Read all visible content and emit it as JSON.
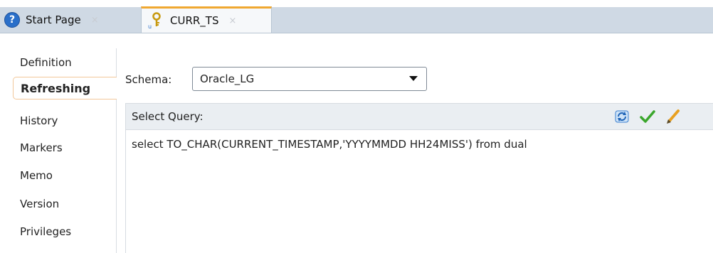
{
  "tabs": [
    {
      "label": "Start Page",
      "icon": "help-icon",
      "close": "×"
    },
    {
      "label": "CURR_TS",
      "icon": "key-icon",
      "close": "×"
    }
  ],
  "help_glyph": "?",
  "nav": {
    "items": [
      "Definition",
      "Refreshing",
      "History",
      "Markers",
      "Memo",
      "Version",
      "Privileges"
    ],
    "active": "Refreshing"
  },
  "schema": {
    "label": "Schema:",
    "value": "Oracle_LG"
  },
  "query": {
    "label": "Select Query:",
    "text": "select TO_CHAR(CURRENT_TIMESTAMP,'YYYYMMDD HH24MISS') from dual",
    "actions": [
      "refresh-icon",
      "check-icon",
      "pencil-icon"
    ]
  },
  "colors": {
    "tab_strip": "#cfd9e4",
    "active_tab_accent": "#f0a830",
    "help_blue": "#2a6fc9",
    "check_green": "#3aa62c",
    "pencil_orange": "#e8a020"
  }
}
